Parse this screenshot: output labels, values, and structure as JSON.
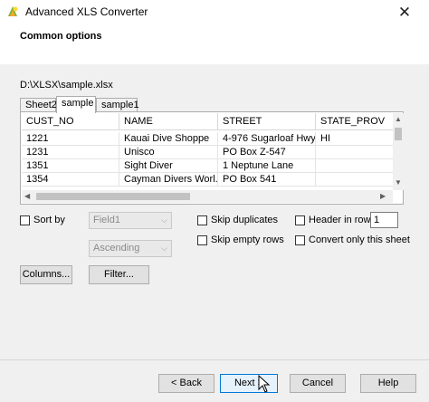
{
  "window": {
    "title": "Advanced XLS Converter",
    "close_glyph": "✕"
  },
  "header": {
    "title": "Common options"
  },
  "file_path": "D:\\XLSX\\sample.xlsx",
  "sheet_tabs": [
    "Sheet2",
    "sample",
    "sample1"
  ],
  "active_tab": "sample",
  "table": {
    "columns": [
      "CUST_NO",
      "NAME",
      "STREET",
      "STATE_PROV"
    ],
    "rows": [
      [
        "1221",
        "Kauai Dive Shoppe",
        "4-976 Sugarloaf Hwy",
        "HI"
      ],
      [
        "1231",
        "Unisco",
        "PO Box Z-547",
        ""
      ],
      [
        "1351",
        "Sight Diver",
        "1 Neptune Lane",
        ""
      ],
      [
        "1354",
        "Cayman Divers Worl...",
        "PO Box 541",
        ""
      ]
    ]
  },
  "options": {
    "sort_by": {
      "label": "Sort by",
      "checked": false
    },
    "field_combo": "Field1",
    "order_combo": "Ascending",
    "skip_duplicates": {
      "label": "Skip duplicates",
      "checked": false
    },
    "skip_empty_rows": {
      "label": "Skip empty rows",
      "checked": false
    },
    "header_in_row": {
      "label": "Header in row",
      "checked": false,
      "value": "1"
    },
    "convert_only_this_sheet": {
      "label": "Convert only this sheet",
      "checked": false
    }
  },
  "buttons": {
    "columns": "Columns...",
    "filter": "Filter...",
    "back": "< Back",
    "next": "Next >",
    "cancel": "Cancel",
    "help": "Help"
  },
  "colors": {
    "focus_border": "#0078d7",
    "panel_bg": "#f0f0f0"
  },
  "icons": [
    "app-icon",
    "close-icon",
    "scroll-up-icon",
    "scroll-down-icon",
    "scroll-left-icon",
    "scroll-right-icon",
    "dropdown-icon",
    "mouse-cursor-icon"
  ]
}
